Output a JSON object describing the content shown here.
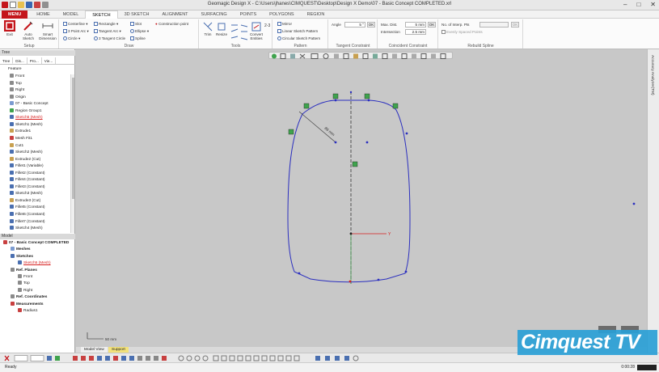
{
  "window": {
    "title": "Geomagic Design X - C:\\Users\\jhanes\\CIMQUEST\\Desktop\\Design X Demo\\07 - Basic Concept COMPLETED.xrl",
    "controls": [
      "–",
      "□",
      "✕"
    ]
  },
  "tabs": [
    "MENU",
    "HOME",
    "MODEL",
    "SKETCH",
    "3D SKETCH",
    "ALIGNMENT",
    "SURFACING",
    "POINTS",
    "POLYGONS",
    "REGION"
  ],
  "active_tab": "SKETCH",
  "ribbon": {
    "setup": {
      "label": "Setup",
      "exit": "Exit",
      "auto_sketch": "Auto Sketch",
      "smart_dimension": "Smart Dimension"
    },
    "draw": {
      "label": "Draw",
      "items": [
        "Centerline",
        "3 Point Arc",
        "Circle",
        "Rectangle",
        "Tangent Arc",
        "3 Tangent Circle",
        "Slot",
        "Ellipse",
        "Spline",
        "Construction point"
      ]
    },
    "tools": {
      "label": "Tools",
      "trim": "Trim",
      "resize": "Resize",
      "convert_entities": "Convert Entities"
    },
    "pattern": {
      "label": "Pattern",
      "mirror": "Mirror",
      "linear": "Linear Sketch Pattern",
      "circular": "Circular Sketch Pattern"
    },
    "tangent": {
      "label": "Tangent Constraint",
      "angle_label": "Angle",
      "angle_value": "5 °",
      "ok": "OK"
    },
    "coincident": {
      "label": "Coincident Constraint",
      "max_dist_label": "Max. Dist.",
      "max_dist_value": "5 mm",
      "intersection_label": "Intersection",
      "intersection_value": "2.5 mm",
      "ok": "OK"
    },
    "rebuild": {
      "label": "Rebuild Spline",
      "pts_label": "No. of Interp. Pts",
      "evenly_label": "Evenly Spaced Points",
      "ok": "OK"
    }
  },
  "tree_panel": {
    "title": "Tree",
    "tabs": [
      "Tree",
      "Dis...",
      "Pro...",
      "Vie..."
    ],
    "feature_label": "Feature",
    "items": [
      {
        "label": "Front",
        "icon": "plane-icon",
        "style": "normal"
      },
      {
        "label": "Top",
        "icon": "plane-icon",
        "style": "normal"
      },
      {
        "label": "Right",
        "icon": "plane-icon",
        "style": "normal"
      },
      {
        "label": "Origin",
        "icon": "origin-icon",
        "style": "normal"
      },
      {
        "label": "07 - Basic Concept",
        "icon": "mesh-icon",
        "style": "normal"
      },
      {
        "label": "Region Group1",
        "icon": "region-group-icon",
        "style": "normal"
      },
      {
        "label": "Sketch5 (Mesh)",
        "icon": "sketch-icon",
        "style": "red"
      },
      {
        "label": "Sketch1 (Mesh)",
        "icon": "sketch-icon",
        "style": "normal"
      },
      {
        "label": "Extrude1",
        "icon": "extrude-icon",
        "style": "normal"
      },
      {
        "label": "Mesh Fit1",
        "icon": "mesh-fit-icon",
        "style": "normal"
      },
      {
        "label": "Cut1",
        "icon": "cut-icon",
        "style": "normal"
      },
      {
        "label": "Sketch2 (Mesh)",
        "icon": "sketch-icon",
        "style": "normal"
      },
      {
        "label": "Extrude2 (Cut)",
        "icon": "extrude-icon",
        "style": "normal"
      },
      {
        "label": "Fillet1 (Variable)",
        "icon": "fillet-icon",
        "style": "normal"
      },
      {
        "label": "Fillet2 (Constant)",
        "icon": "fillet-icon",
        "style": "normal"
      },
      {
        "label": "Fillet4 (Constant)",
        "icon": "fillet-icon",
        "style": "normal"
      },
      {
        "label": "Fillet3 (Constant)",
        "icon": "fillet-icon",
        "style": "normal"
      },
      {
        "label": "Sketch3 (Mesh)",
        "icon": "sketch-icon",
        "style": "normal"
      },
      {
        "label": "Extrude3 (Cut)",
        "icon": "extrude-icon",
        "style": "normal"
      },
      {
        "label": "Fillet5 (Constant)",
        "icon": "fillet-icon",
        "style": "normal"
      },
      {
        "label": "Fillet6 (Constant)",
        "icon": "fillet-icon",
        "style": "normal"
      },
      {
        "label": "Fillet7 (Constant)",
        "icon": "fillet-icon",
        "style": "normal"
      },
      {
        "label": "Sketch4 (Mesh)",
        "icon": "sketch-icon",
        "style": "normal"
      }
    ]
  },
  "model_panel": {
    "title": "Model",
    "items": [
      {
        "label": "07 - Basic Concept COMPLETED",
        "icon": "model-icon",
        "style": "bold",
        "indent": 0
      },
      {
        "label": "Meshes",
        "icon": "mesh-icon",
        "style": "bold",
        "indent": 1
      },
      {
        "label": "Sketches",
        "icon": "sketch-icon",
        "style": "bold",
        "indent": 1
      },
      {
        "label": "Sketch5 (Mesh)",
        "icon": "sketch-icon",
        "style": "red",
        "indent": 2
      },
      {
        "label": "Ref. Planes",
        "icon": "plane-icon",
        "style": "bold",
        "indent": 1
      },
      {
        "label": "Front",
        "icon": "plane-icon",
        "style": "normal",
        "indent": 2
      },
      {
        "label": "Top",
        "icon": "plane-icon",
        "style": "normal",
        "indent": 2
      },
      {
        "label": "Right",
        "icon": "plane-icon",
        "style": "normal",
        "indent": 2
      },
      {
        "label": "Ref. Coordinates",
        "icon": "coordinates-icon",
        "style": "bold",
        "indent": 1
      },
      {
        "label": "Measurements",
        "icon": "measure-icon",
        "style": "bold",
        "indent": 1
      },
      {
        "label": "Radius1",
        "icon": "radius-icon",
        "style": "normal",
        "indent": 2
      }
    ]
  },
  "viewport": {
    "dimension_label": "86 mm",
    "axis_label": "Y",
    "scale_label": "50 mm"
  },
  "right_panel": {
    "label": "Accuracy Analyzer(TM)"
  },
  "bottom_tabs": [
    "Model View",
    "Support"
  ],
  "status": {
    "left": "Ready",
    "right": "0:00:28"
  },
  "watermark": {
    "text": "Cimquest TV"
  },
  "colors": {
    "accent": "#c4161c",
    "sketch": "#2b2fbf",
    "constraint": "#3fa34d",
    "watermark": "#2a9fd6"
  }
}
